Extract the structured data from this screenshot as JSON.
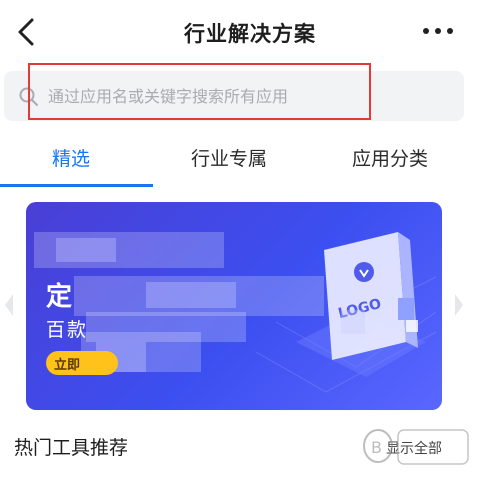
{
  "header": {
    "title": "行业解决方案"
  },
  "search": {
    "placeholder": "通过应用名或关键字搜索所有应用",
    "value": ""
  },
  "tabs": [
    {
      "label": "精选",
      "active": true
    },
    {
      "label": "行业专属",
      "active": false
    },
    {
      "label": "应用分类",
      "active": false
    }
  ],
  "banner": {
    "title_visible": "定",
    "subtitle_visible": "百款",
    "button_visible": "立即",
    "logo_text": "LOGO"
  },
  "section": {
    "title": "热门工具推荐",
    "view_all": "显示全部"
  },
  "colors": {
    "accent": "#1976f0",
    "highlight": "#e53935",
    "banner_start": "#4a3fd6",
    "banner_end": "#5a67ff",
    "button": "#ffc21a"
  },
  "icons": [
    "back-arrow-icon",
    "more-dots-icon",
    "search-icon",
    "carousel-left-icon",
    "carousel-right-icon"
  ]
}
